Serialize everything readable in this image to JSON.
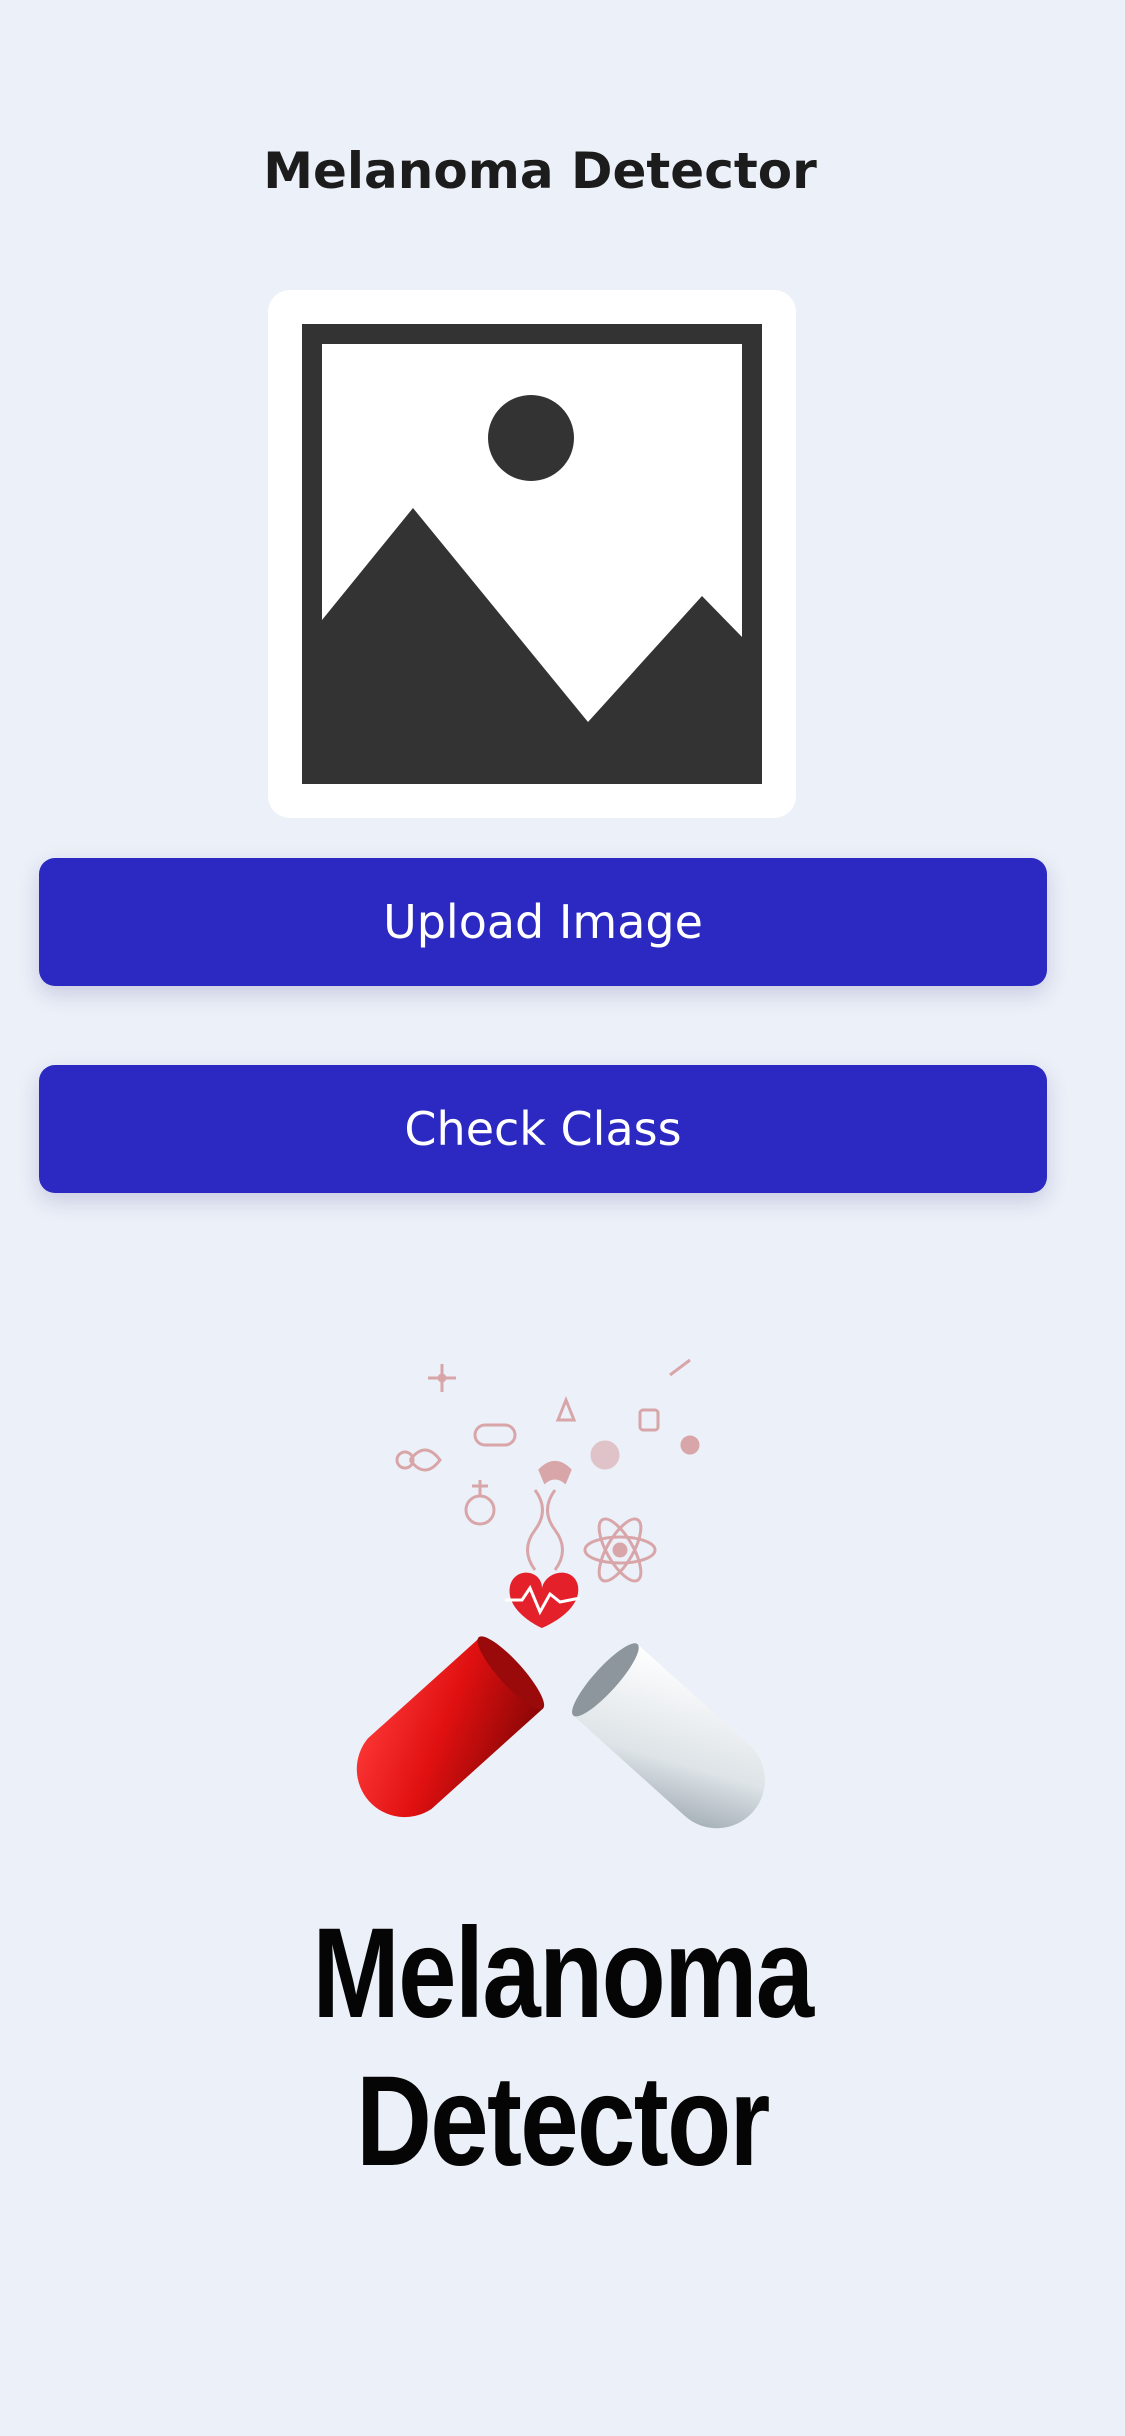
{
  "app": {
    "title": "Melanoma Detector"
  },
  "preview": {
    "icon": "image-placeholder-icon"
  },
  "buttons": {
    "upload_label": "Upload Image",
    "check_label": "Check Class"
  },
  "logo": {
    "icon": "medicine-capsule-icon",
    "line1": "Melanoma",
    "line2": "Detector"
  },
  "colors": {
    "background": "#ecf0f8",
    "button": "#2b29c2",
    "button_text": "#ffffff"
  }
}
